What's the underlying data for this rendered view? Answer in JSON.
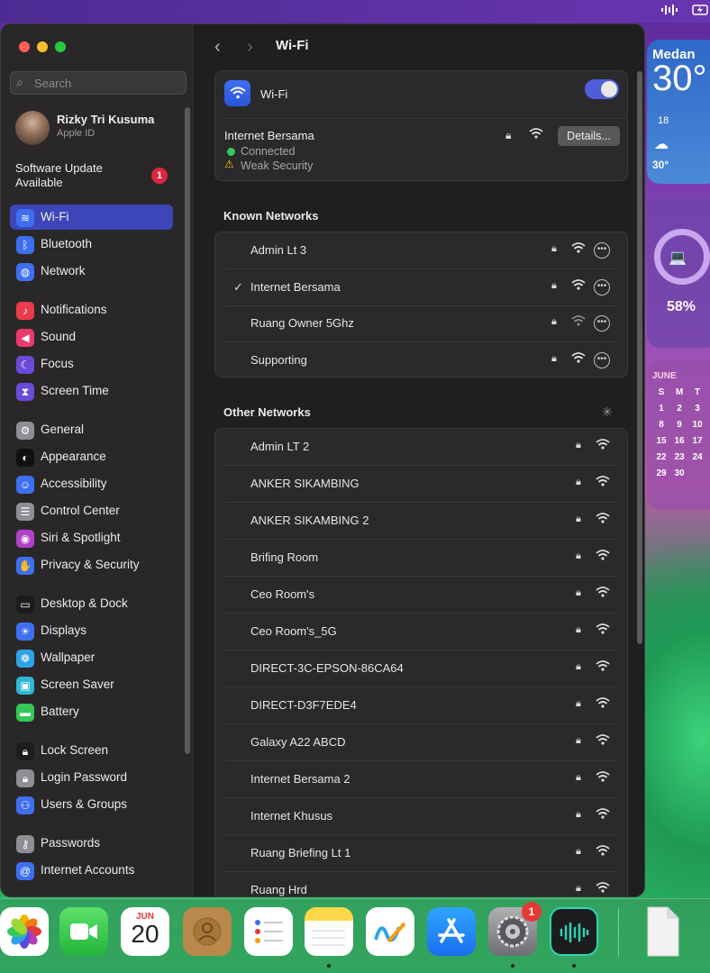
{
  "menubar": {
    "icons": [
      "waveform-icon",
      "battery-charging-icon"
    ]
  },
  "widgets": {
    "weather": {
      "city": "Medan",
      "temp": "30°",
      "hour": "18",
      "hour_temp": "30°"
    },
    "battery": {
      "percent": "58%"
    },
    "calendar": {
      "month": "JUNE",
      "weekday_header": [
        "S",
        "M",
        "T"
      ],
      "rows": [
        [
          "1",
          "2",
          "3"
        ],
        [
          "8",
          "9",
          "10"
        ],
        [
          "15",
          "16",
          "17"
        ],
        [
          "22",
          "23",
          "24"
        ],
        [
          "29",
          "30",
          ""
        ]
      ]
    }
  },
  "sidebar": {
    "search_placeholder": "Search",
    "profile": {
      "name": "Rizky Tri Kusuma",
      "subtitle": "Apple ID"
    },
    "software_update": {
      "label": "Software Update Available",
      "badge": "1"
    },
    "items": [
      {
        "label": "Wi-Fi",
        "icon": "wifi-icon",
        "color": "#3f6ff1",
        "selected": true
      },
      {
        "label": "Bluetooth",
        "icon": "bluetooth-icon",
        "color": "#3f6ff1"
      },
      {
        "label": "Network",
        "icon": "globe-icon",
        "color": "#3f6ff1"
      },
      {
        "label": "Notifications",
        "icon": "bell-icon",
        "color": "#ea3b4a"
      },
      {
        "label": "Sound",
        "icon": "speaker-icon",
        "color": "#ea3b6d"
      },
      {
        "label": "Focus",
        "icon": "moon-icon",
        "color": "#6a4ad8"
      },
      {
        "label": "Screen Time",
        "icon": "hourglass-icon",
        "color": "#6a4ad8"
      },
      {
        "label": "General",
        "icon": "gear-icon",
        "color": "#8e8e93"
      },
      {
        "label": "Appearance",
        "icon": "appearance-icon",
        "color": "#111111"
      },
      {
        "label": "Accessibility",
        "icon": "accessibility-icon",
        "color": "#3f6ff1"
      },
      {
        "label": "Control Center",
        "icon": "control-center-icon",
        "color": "#8e8e93"
      },
      {
        "label": "Siri & Spotlight",
        "icon": "siri-icon",
        "color": "#b340c8"
      },
      {
        "label": "Privacy & Security",
        "icon": "hand-icon",
        "color": "#3f6ff1"
      },
      {
        "label": "Desktop & Dock",
        "icon": "dock-icon",
        "color": "#1c1c1e"
      },
      {
        "label": "Displays",
        "icon": "sun-icon",
        "color": "#3f6ff1"
      },
      {
        "label": "Wallpaper",
        "icon": "wallpaper-icon",
        "color": "#2ea4e8"
      },
      {
        "label": "Screen Saver",
        "icon": "screensaver-icon",
        "color": "#2fb7d6"
      },
      {
        "label": "Battery",
        "icon": "battery-icon",
        "color": "#34c759"
      },
      {
        "label": "Lock Screen",
        "icon": "lock-screen-icon",
        "color": "#1c1c1e"
      },
      {
        "label": "Login Password",
        "icon": "lock-icon",
        "color": "#8e8e93"
      },
      {
        "label": "Users & Groups",
        "icon": "users-icon",
        "color": "#3f6ff1"
      },
      {
        "label": "Passwords",
        "icon": "key-icon",
        "color": "#8e8e93"
      },
      {
        "label": "Internet Accounts",
        "icon": "at-icon",
        "color": "#3f6ff1"
      }
    ]
  },
  "main": {
    "title": "Wi-Fi",
    "wifi_label": "Wi-Fi",
    "wifi_enabled": true,
    "current_network": {
      "name": "Internet Bersama",
      "status": "Connected",
      "security_warning": "Weak Security",
      "details_label": "Details..."
    },
    "known_title": "Known Networks",
    "known_networks": [
      {
        "name": "Admin Lt 3",
        "connected": false
      },
      {
        "name": "Internet Bersama",
        "connected": true
      },
      {
        "name": "Ruang Owner 5Ghz",
        "connected": false
      },
      {
        "name": "Supporting",
        "connected": false
      }
    ],
    "other_title": "Other Networks",
    "other_networks": [
      "Admin LT 2",
      "ANKER SIKAMBING",
      "ANKER SIKAMBING 2",
      "Brifing Room",
      "Ceo Room's",
      "Ceo Room's_5G",
      "DIRECT-3C-EPSON-86CA64",
      "DIRECT-D3F7EDE4",
      "Galaxy A22 ABCD",
      "Internet Bersama 2",
      "Internet Khusus",
      "Ruang Briefing Lt 1",
      "Ruang Hrd"
    ]
  },
  "dock": {
    "calendar_month": "JUN",
    "calendar_day": "20",
    "settings_badge": "1",
    "apps": [
      "photos-icon",
      "facetime-icon",
      "calendar-icon",
      "contacts-icon",
      "reminders-icon",
      "notes-icon",
      "freeform-icon",
      "app-store-icon",
      "system-settings-icon",
      "voice-memos-icon",
      "document-icon"
    ]
  }
}
